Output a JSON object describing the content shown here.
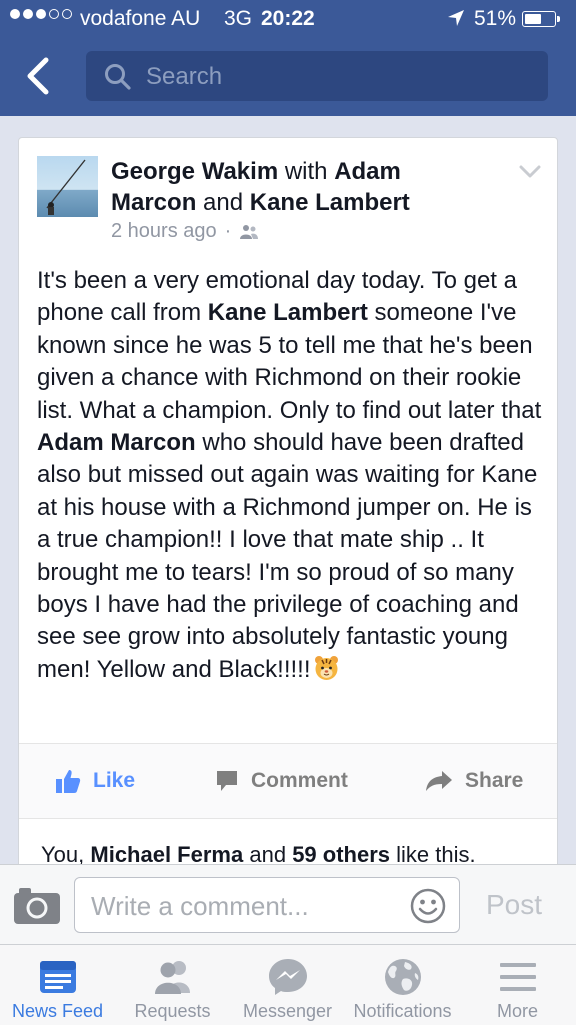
{
  "status_bar": {
    "carrier": "vodafone AU",
    "network": "3G",
    "time": "20:22",
    "battery_percent": "51%",
    "battery_level": 0.51,
    "signal_bars_filled": 3,
    "signal_bars_total": 5
  },
  "nav": {
    "search_placeholder": "Search"
  },
  "post": {
    "author": "George Wakim",
    "with_word": "with",
    "tagged_1": "Adam",
    "tagged_1b": "Marcon",
    "and_word": "and",
    "tagged_2": "Kane Lambert",
    "time_ago": "2 hours ago",
    "separator": "·",
    "audience_icon": "friends-icon",
    "text_parts": {
      "p1": "It's been a very emotional day today. To get a phone call from ",
      "m1": "Kane Lambert",
      "p2": " someone I've known since he was 5 to tell me that he's been given a chance with Richmond on their rookie list. What a champion. Only to find out later that ",
      "m2": "Adam Marcon",
      "p3": " who should have been drafted also but missed out again was waiting for Kane at his house with a Richmond jumper on. He is a true champion!! I love that mate ship .. It brought me to tears! I'm so proud of so many boys I have had the privilege of coaching and see see grow into absolutely fantastic young men! Yellow and Black!!!!!"
    },
    "emoji": "tiger-face-emoji"
  },
  "actions": {
    "like": "Like",
    "comment": "Comment",
    "share": "Share"
  },
  "likes_summary": {
    "you": "You,",
    "person": "Michael Ferma",
    "and_word": "and",
    "others": "59 others",
    "suffix": "like this."
  },
  "comment_bar": {
    "placeholder": "Write a comment...",
    "post_label": "Post"
  },
  "tabs": [
    {
      "label": "News Feed",
      "icon": "news-feed-icon",
      "active": true
    },
    {
      "label": "Requests",
      "icon": "friend-requests-icon",
      "active": false
    },
    {
      "label": "Messenger",
      "icon": "messenger-icon",
      "active": false
    },
    {
      "label": "Notifications",
      "icon": "globe-icon",
      "active": false
    },
    {
      "label": "More",
      "icon": "menu-icon",
      "active": false
    }
  ],
  "colors": {
    "brand_blue": "#3b5998",
    "link_blue": "#5890ff",
    "active_tab": "#3b7be0",
    "muted_grey": "#9197a3"
  }
}
